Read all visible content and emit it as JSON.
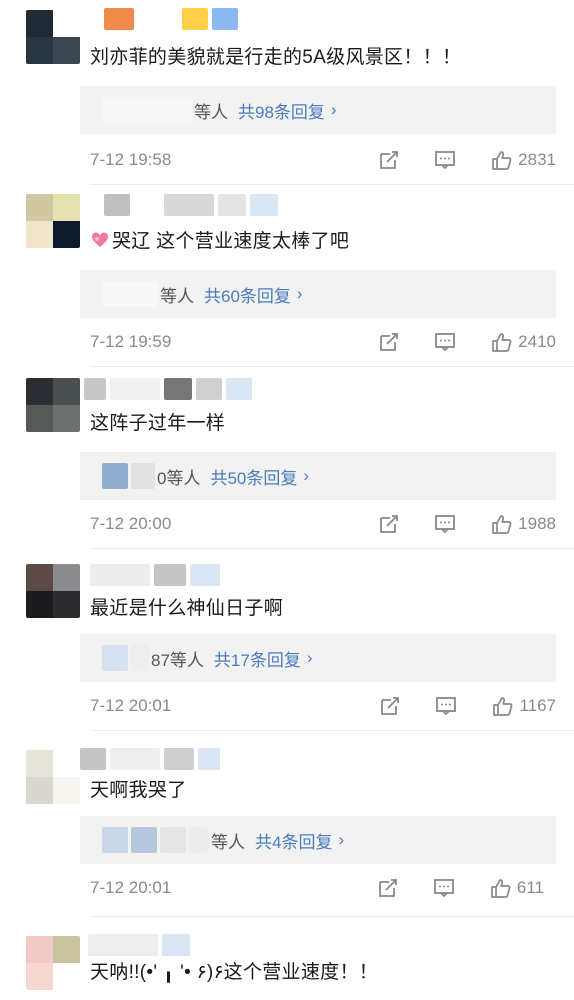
{
  "colors": {
    "reply_link": "#4a7bbd",
    "meta_gray": "#8a8a8a",
    "reply_bg": "#f2f2f2"
  },
  "comments": [
    {
      "text": "刘亦菲的美貌就是行走的5A级风景区！！！",
      "reply_who": "等人",
      "reply_count": "共98条回复",
      "time": "7-12 19:58",
      "likes": "2831"
    },
    {
      "text": "哭辽 这个营业速度太棒了吧",
      "emoji": "heart-emoji",
      "reply_who": "等人",
      "reply_count": "共60条回复",
      "time": "7-12 19:59",
      "likes": "2410"
    },
    {
      "text": "这阵子过年一样",
      "reply_who": "0等人",
      "reply_count": "共50条回复",
      "time": "7-12 20:00",
      "likes": "1988"
    },
    {
      "text": "最近是什么神仙日子啊",
      "reply_who": "87等人",
      "reply_count": "共17条回复",
      "time": "7-12 20:01",
      "likes": "1167"
    },
    {
      "text": "天啊我哭了",
      "reply_who": "等人",
      "reply_count": "共4条回复",
      "time": "7-12 20:01",
      "likes": "611"
    },
    {
      "text": "天呐!!(•' ╻ '• ۶)۶这个营业速度！！"
    }
  ],
  "icons": {
    "reply_chevron": "›",
    "repost": "repost-icon",
    "comment": "comment-icon",
    "like": "thumbs-up-icon"
  }
}
